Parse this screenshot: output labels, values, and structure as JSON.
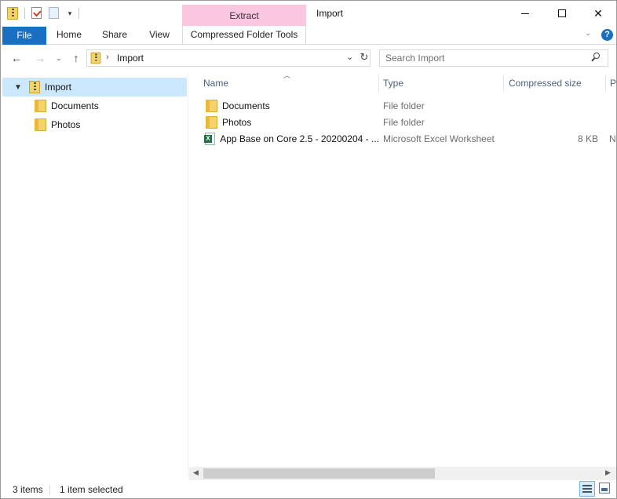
{
  "window": {
    "title": "Import",
    "contextual_tab_group": "Extract"
  },
  "ribbon": {
    "tabs": [
      {
        "label": "File"
      },
      {
        "label": "Home"
      },
      {
        "label": "Share"
      },
      {
        "label": "View"
      },
      {
        "label": "Compressed Folder Tools"
      }
    ]
  },
  "address_bar": {
    "path": [
      "Import"
    ]
  },
  "search": {
    "placeholder": "Search Import"
  },
  "nav_pane": {
    "items": [
      {
        "label": "Import",
        "icon": "zip-folder-icon",
        "selected": true,
        "expanded": true
      },
      {
        "label": "Documents",
        "icon": "folder-icon"
      },
      {
        "label": "Photos",
        "icon": "folder-icon"
      }
    ]
  },
  "file_list": {
    "columns": [
      "Name",
      "Type",
      "Compressed size",
      "P"
    ],
    "rows": [
      {
        "name": "Documents",
        "type": "File folder",
        "size": "",
        "extra": "",
        "icon": "folder-icon"
      },
      {
        "name": "Photos",
        "type": "File folder",
        "size": "",
        "extra": "",
        "icon": "folder-icon"
      },
      {
        "name": "App Base on Core 2.5 - 20200204 - ...",
        "type": "Microsoft Excel Worksheet",
        "size": "8 KB",
        "extra": "N",
        "icon": "excel-icon"
      }
    ]
  },
  "status_bar": {
    "item_count": "3 items",
    "selection": "1 item selected"
  },
  "colors": {
    "accent": "#1a6fc0",
    "contextual_tab": "#fbc6e0",
    "selection": "#cce8ff"
  }
}
